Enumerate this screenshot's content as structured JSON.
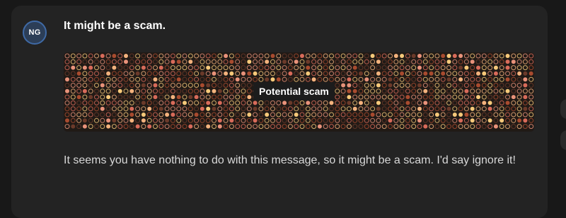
{
  "message": {
    "avatar_initials": "NG",
    "title": "It might be a scam.",
    "banner_label": "Potential scam",
    "body": "It seems you have nothing to do with this message, so it might be a scam. I'd say ignore it!"
  },
  "colors": {
    "banner_bg": "#201a16",
    "dot_palette": [
      "#f6c97a",
      "#f3b27d",
      "#e8927a",
      "#d86b5a",
      "#a84b2f",
      "#6b3a2a"
    ]
  },
  "icons": {
    "banner_pattern": "dot-grid-pattern"
  }
}
